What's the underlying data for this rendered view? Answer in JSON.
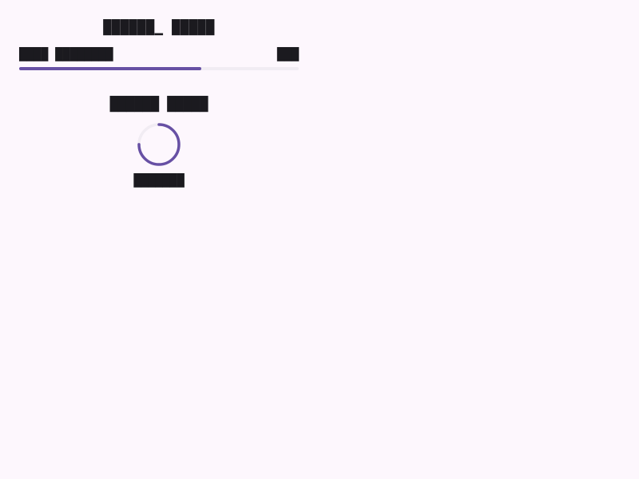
{
  "header": {
    "title": "██████▁ █████"
  },
  "progress": {
    "label": "████ ████████",
    "value_text": "███",
    "fraction": 0.65
  },
  "loading": {
    "title": "██████ █████",
    "status": "███████",
    "spinner_fraction": 0.75
  },
  "colors": {
    "accent": "#6750a4",
    "track": "#f1ecf3",
    "background": "#fdf7fd",
    "text": "#1b1a1f"
  }
}
